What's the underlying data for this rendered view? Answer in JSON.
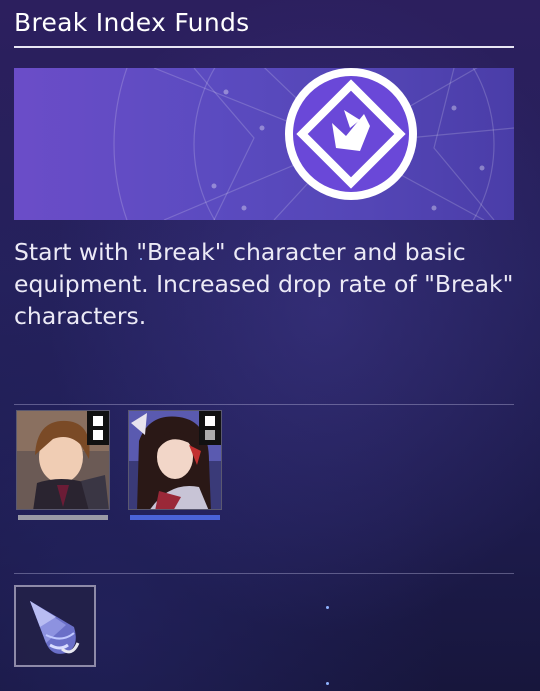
{
  "header": {
    "title": "Break Index Funds"
  },
  "banner": {
    "emblem_icon": "break-path-icon"
  },
  "description": "Start with \"Break\" character and basic equipment. Increased drop rate of \"Break\" characters.",
  "characters": [
    {
      "name_icon": "character-portrait-brown-hair",
      "bar_color": "#9a9aa6",
      "badge": "path-badge-icon"
    },
    {
      "name_icon": "character-portrait-dark-hair",
      "bar_color": "#4a63d8",
      "badge": "path-badge-icon"
    }
  ],
  "equipment": {
    "icon": "crystal-cone-icon"
  }
}
